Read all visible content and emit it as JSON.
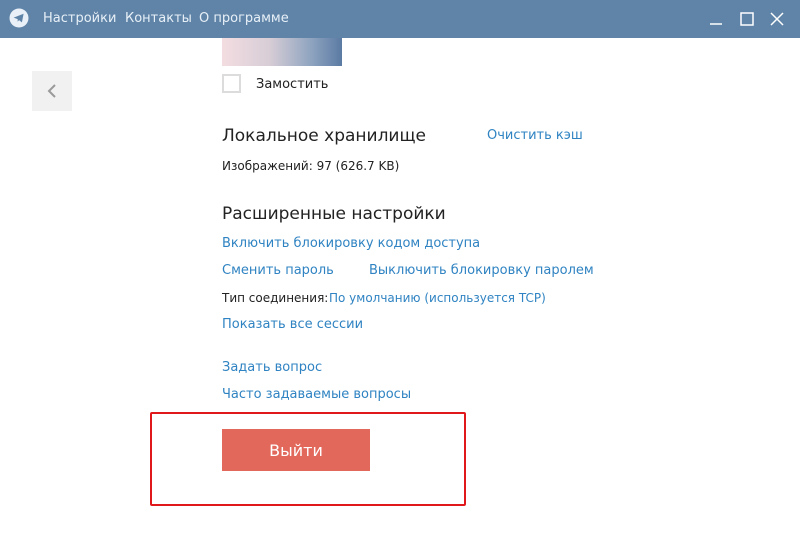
{
  "titlebar": {
    "menu": [
      "Настройки",
      "Контакты",
      "О программе"
    ],
    "icons": [
      "telegram-logo-icon",
      "minimize-icon",
      "maximize-icon",
      "close-icon"
    ]
  },
  "background": {
    "tile_label": "Замостить",
    "tile_checked": false
  },
  "local_storage": {
    "title": "Локальное хранилище",
    "clear_cache": "Очистить кэш",
    "images_info": "Изображений: 97  (626.7 KB)"
  },
  "advanced": {
    "title": "Расширенные настройки",
    "enable_passcode": "Включить блокировку кодом доступа",
    "change_password": "Сменить пароль",
    "disable_password": "Выключить блокировку паролем",
    "connection_label": "Тип соединения:",
    "connection_value": "По умолчанию (используется TCP)",
    "show_sessions": "Показать все сессии",
    "ask_question": "Задать вопрос",
    "faq": "Часто задаваемые вопросы"
  },
  "logout_label": "Выйти",
  "colors": {
    "titlebar": "#5f84a8",
    "link": "#2f83c2",
    "logout": "#e2685c",
    "highlight": "#e0181c"
  }
}
